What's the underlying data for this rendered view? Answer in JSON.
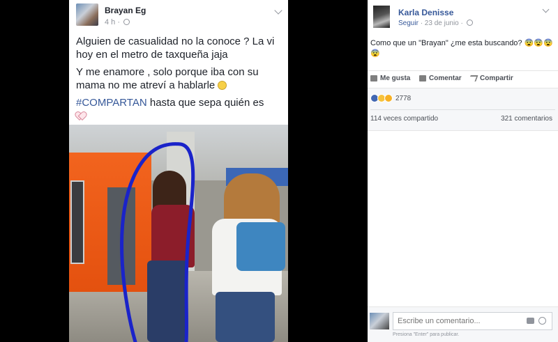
{
  "post": {
    "author": "Brayan Eg",
    "time": "4 h ·",
    "text1": "Alguien de casualidad no la conoce ? La vi hoy en el metro de taxqueña jaja",
    "text2": "Y me enamore , solo porque iba con su mama no me atreví a hablarle",
    "hashtag": "#COMPARTAN",
    "text3": " hasta que sepa quién es"
  },
  "comment_panel": {
    "author": "Karla Denisse",
    "follow": "Seguir",
    "date": "· 23 de junio ·",
    "text": "Como que un \"Brayan\" ¿me esta buscando? 😨😨😨😨",
    "actions": {
      "like": "Me gusta",
      "comment": "Comentar",
      "share": "Compartir"
    },
    "reaction_count": "2778",
    "shares": "114 veces compartido",
    "comments": "321 comentarios",
    "composer": {
      "placeholder": "Escribe un comentario...",
      "hint": "Presiona \"Enter\" para publicar."
    }
  }
}
